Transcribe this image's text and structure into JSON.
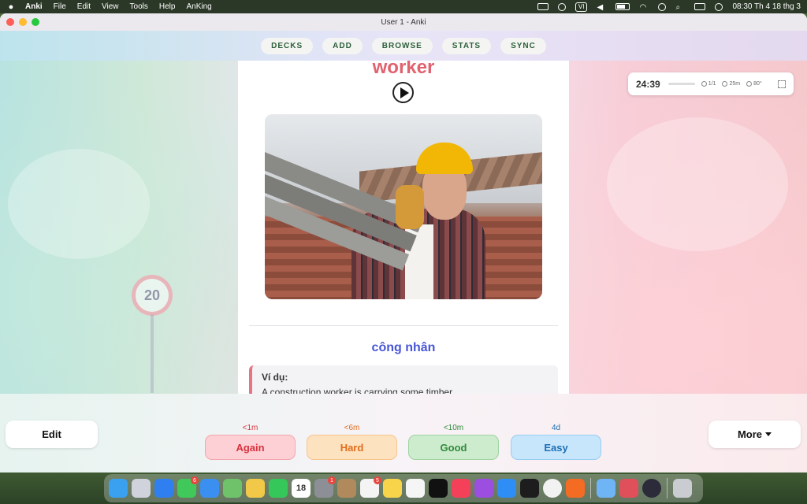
{
  "menubar": {
    "app_name": "Anki",
    "menus": [
      "File",
      "Edit",
      "View",
      "Tools",
      "Help",
      "AnKing"
    ],
    "input_source": "VI",
    "clock": "08:30 Th 4 18 thg 3"
  },
  "window": {
    "title": "User 1 - Anki"
  },
  "nav": {
    "items": [
      "DECKS",
      "ADD",
      "BROWSE",
      "STATS",
      "SYNC"
    ]
  },
  "card": {
    "word": "worker",
    "meaning": "công nhân",
    "example_label": "Ví dụ:",
    "example_text": "A construction worker is carrying some timber."
  },
  "scene": {
    "sign_text": "20"
  },
  "timer": {
    "time": "24:39",
    "cards": "1/1",
    "minutes": "25m",
    "temp": "80°"
  },
  "answer_bar": {
    "edit_label": "Edit",
    "more_label": "More",
    "again": {
      "label": "Again",
      "interval": "<1m",
      "color": "#d8323d"
    },
    "hard": {
      "label": "Hard",
      "interval": "<6m",
      "color": "#e06d1c"
    },
    "good": {
      "label": "Good",
      "interval": "<10m",
      "color": "#2f8a3a"
    },
    "easy": {
      "label": "Easy",
      "interval": "4d",
      "color": "#1e6fb3"
    }
  },
  "dock": {
    "calendar_day": "18",
    "messages_badge": "6",
    "settings_badge": "1",
    "reminders_badge": "5"
  }
}
